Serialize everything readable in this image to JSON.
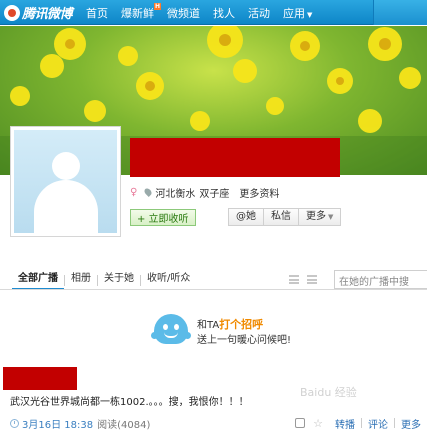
{
  "topnav": {
    "logo_text": "腾讯微博",
    "items": [
      {
        "label": "首页"
      },
      {
        "label": "爆新鲜",
        "badge": "H"
      },
      {
        "label": "微频道"
      },
      {
        "label": "找人"
      },
      {
        "label": "活动"
      },
      {
        "label": "应用",
        "caret": "▼"
      }
    ]
  },
  "profile": {
    "gender_icon": "♀",
    "location": "河北衡水",
    "zodiac": "双子座",
    "more_info": "更多资料",
    "follow_button": "+ 立即收听",
    "actions": [
      {
        "label": "@她"
      },
      {
        "label": "私信"
      },
      {
        "label": "更多",
        "caret": "▼"
      }
    ]
  },
  "tabs": [
    {
      "label": "全部广播",
      "active": true
    },
    {
      "label": "相册"
    },
    {
      "label": "关于她"
    },
    {
      "label": "收听/听众"
    }
  ],
  "search": {
    "placeholder": "在她的广播中搜"
  },
  "greeting": {
    "line1_prefix": "和TA",
    "line1_highlight": "打个招呼",
    "line2": "送上一句暖心问候吧!"
  },
  "post": {
    "text": "武汉光谷世界城尚都一栋1002.。。。搜，我恨你！！！",
    "date": "3月16日 18:38",
    "reads": "阅读(4084)",
    "actions": [
      {
        "label": "转播"
      },
      {
        "label": "评论"
      },
      {
        "label": "更多"
      }
    ]
  },
  "watermark": "Baidu 经验",
  "colors": {
    "nav_blue": "#1e96d6",
    "redaction": "#c20000",
    "follow_green": "#2a7a10",
    "highlight_orange": "#f08a00",
    "link_blue": "#2b6fb4"
  }
}
